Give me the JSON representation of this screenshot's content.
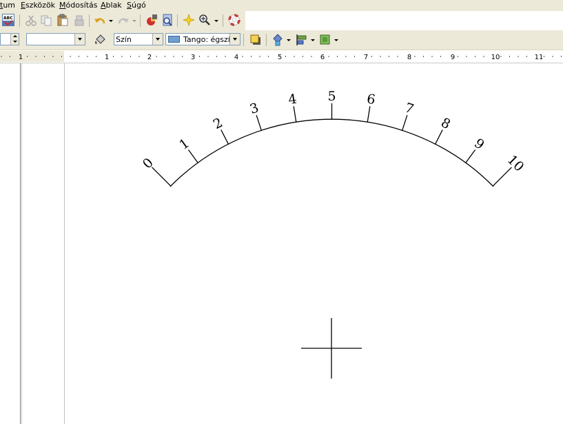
{
  "menu": {
    "items": [
      "tum",
      "Eszközök",
      "Módosítás",
      "Ablak",
      "Súgó"
    ]
  },
  "toolbar": {
    "color_combo_value": "Szín",
    "fill_combo_value": "Tango: égszín",
    "fill_swatch_color": "#729fcf"
  },
  "ruler": {
    "labels": [
      "1",
      "1",
      "2",
      "3",
      "4",
      "5",
      "6",
      "7",
      "8",
      "9",
      "10",
      "11"
    ]
  },
  "drawing": {
    "scale_labels": [
      "0",
      "1",
      "2",
      "3",
      "4",
      "5",
      "6",
      "7",
      "8",
      "9",
      "10"
    ]
  }
}
